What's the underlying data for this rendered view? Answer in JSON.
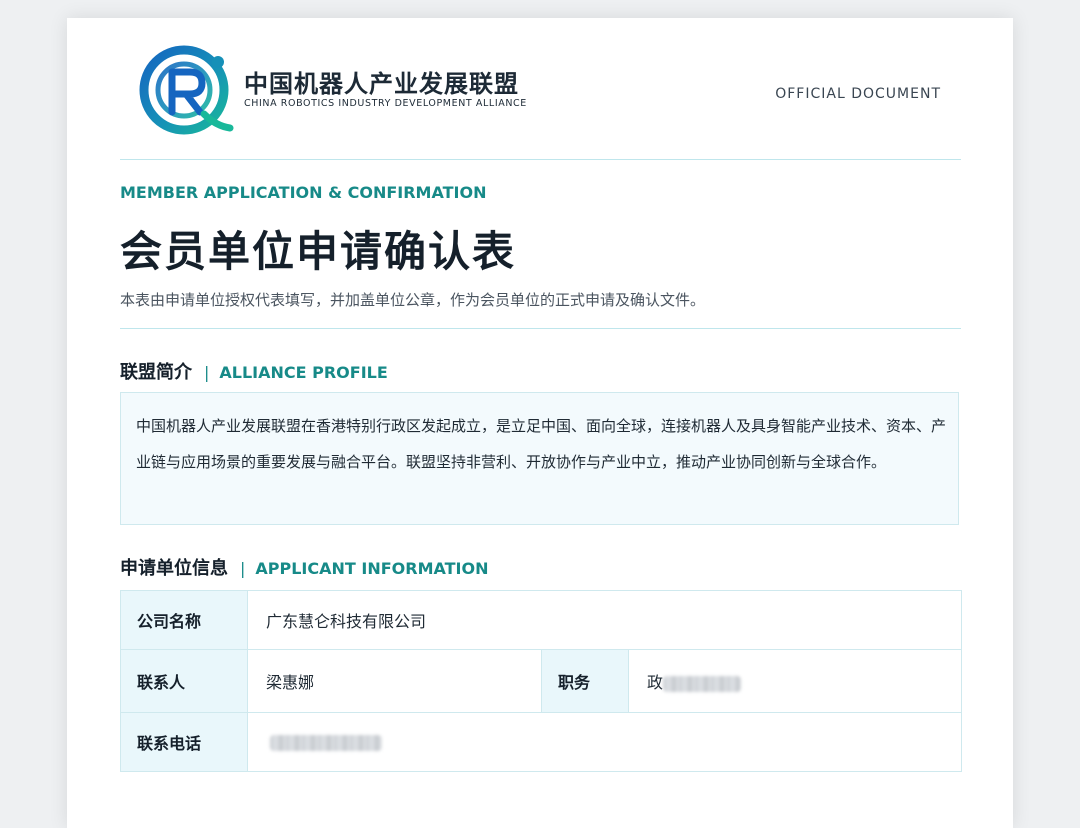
{
  "header": {
    "org_name_cn": "中国机器人产业发展联盟",
    "org_name_en": "CHINA ROBOTICS INDUSTRY DEVELOPMENT ALLIANCE",
    "doc_label": "OFFICIAL  DOCUMENT",
    "logo_letter": "R"
  },
  "form": {
    "eyebrow": "MEMBER APPLICATION  &  CONFIRMATION",
    "title": "会员单位申请确认表",
    "subtitle": "本表由申请单位授权代表填写，并加盖单位公章，作为会员单位的正式申请及确认文件。"
  },
  "alliance_profile": {
    "heading_cn": "联盟简介",
    "separator": "|",
    "heading_en": "ALLIANCE PROFILE",
    "text": "中国机器人产业发展联盟在香港特别行政区发起成立，是立足中国、面向全球，连接机器人及具身智能产业技术、资本、产业链与应用场景的重要发展与融合平台。联盟坚持非营利、开放协作与产业中立，推动产业协同创新与全球合作。"
  },
  "applicant_info": {
    "heading_cn": "申请单位信息",
    "separator": "|",
    "heading_en": "APPLICANT INFORMATION",
    "company_label": "公司名称",
    "company_value": "广东慧仑科技有限公司",
    "contact_label": "联系人",
    "contact_value": "梁惠娜",
    "position_label": "职务",
    "position_value_visible": "政",
    "phone_label": "联系电话"
  },
  "colors": {
    "accent_teal": "#178a88",
    "heading_dark": "#15202b",
    "label_cell_bg": "#e9f7fb",
    "profile_bg": "#f3fafd",
    "rule": "#bfe6ec"
  }
}
